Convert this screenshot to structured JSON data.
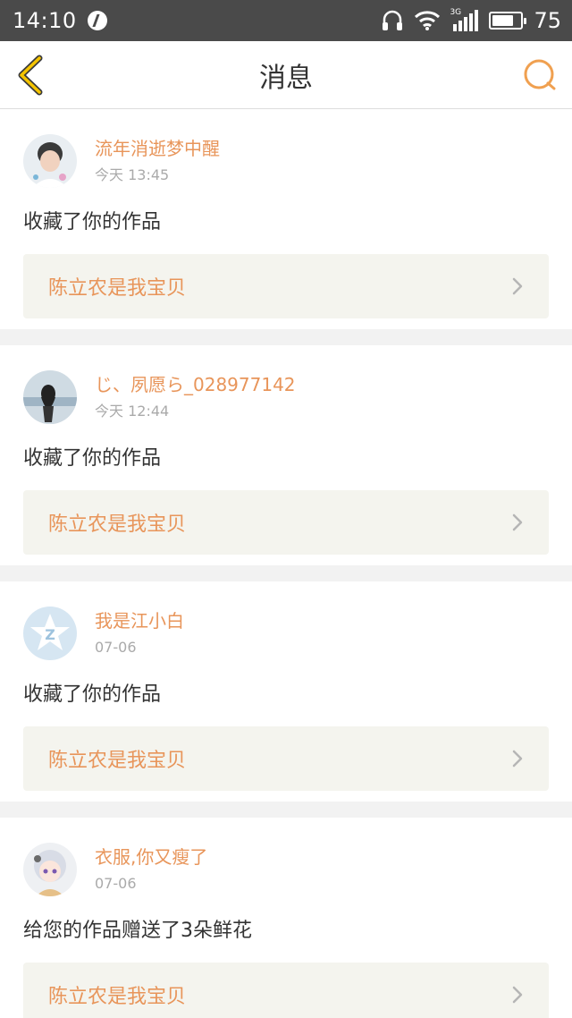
{
  "status_bar": {
    "time": "14:10",
    "network": "3G",
    "battery": "75",
    "battery_level": 0.75
  },
  "nav": {
    "title": "消息",
    "back_icon": "back-chevron-icon",
    "search_icon": "search-icon",
    "accent_color": "#f0a050"
  },
  "messages": [
    {
      "username": "流年消逝梦中醒",
      "time": "今天 13:45",
      "action": "收藏了你的作品",
      "work_title": "陈立农是我宝贝"
    },
    {
      "username": "じ、夙愿ら_028977142",
      "time": "今天 12:44",
      "action": "收藏了你的作品",
      "work_title": "陈立农是我宝贝"
    },
    {
      "username": "我是江小白",
      "time": "07-06",
      "action": "收藏了你的作品",
      "work_title": "陈立农是我宝贝"
    },
    {
      "username": "衣服,你又瘦了",
      "time": "07-06",
      "action": "给您的作品赠送了3朵鲜花",
      "work_title": "陈立农是我宝贝"
    }
  ],
  "colors": {
    "username": "#e8955a",
    "time": "#aaaaaa",
    "card_link_bg": "#f4f4ee",
    "page_bg": "#f2f2f2"
  }
}
